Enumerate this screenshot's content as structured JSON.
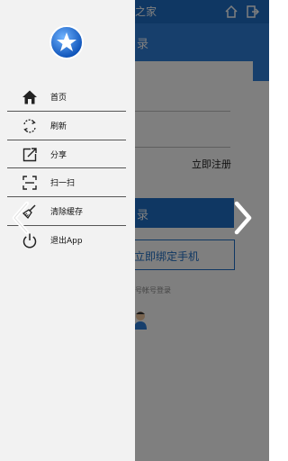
{
  "background": {
    "topbar_title": "之家",
    "header_title": "录",
    "register_link": "立即注册",
    "login_button": "录",
    "bind_button": "立即绑定手机",
    "other_login_text": "号帐号登录"
  },
  "drawer": {
    "logo": "star-logo",
    "menu": [
      {
        "label": "首页",
        "icon": "home-icon"
      },
      {
        "label": "刷新",
        "icon": "refresh-icon"
      },
      {
        "label": "分享",
        "icon": "share-icon"
      },
      {
        "label": "扫一扫",
        "icon": "scan-icon"
      },
      {
        "label": "清除缓存",
        "icon": "broom-icon"
      },
      {
        "label": "退出App",
        "icon": "power-icon"
      }
    ]
  },
  "colors": {
    "accent": "#1f6fc6",
    "header": "#2f7ed8",
    "drawer_bg": "#f2f2f2",
    "overlay": "rgba(0,0,0,0.5)"
  }
}
